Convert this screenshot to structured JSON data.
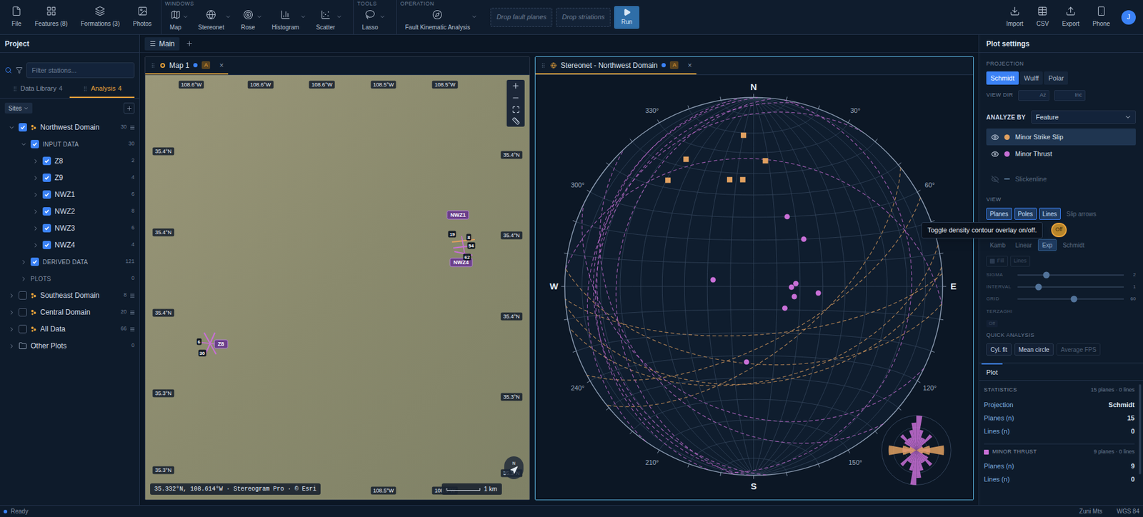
{
  "toolbar": {
    "file_items": [
      {
        "label": "File"
      },
      {
        "label": "Features (8)"
      },
      {
        "label": "Formations (3)"
      },
      {
        "label": "Photos"
      }
    ],
    "groups": [
      {
        "title": "WINDOWS",
        "items": [
          {
            "label": "Map",
            "menu": true
          },
          {
            "label": "Stereonet",
            "menu": true
          },
          {
            "label": "Rose",
            "menu": true
          },
          {
            "label": "Histogram",
            "menu": true
          },
          {
            "label": "Scatter",
            "menu": true
          }
        ]
      },
      {
        "title": "TOOLS",
        "items": [
          {
            "label": "Lasso",
            "menu": true
          }
        ]
      },
      {
        "title": "OPERATION",
        "items": [
          {
            "label": "Fault Kinematic Analysis",
            "menu": true
          }
        ]
      }
    ],
    "drop_zones": [
      "Drop fault planes",
      "Drop striations"
    ],
    "run": {
      "label": "Run",
      "disabled": false
    },
    "right_items": [
      {
        "label": "Import"
      },
      {
        "label": "CSV"
      },
      {
        "label": "Export"
      },
      {
        "label": "Phone"
      }
    ],
    "avatar": "J"
  },
  "sidebar": {
    "title": "Project",
    "filter_placeholder": "Filter stations...",
    "tabs": [
      {
        "label": "Data Library",
        "count": "4",
        "selected": false
      },
      {
        "label": "Analysis",
        "count": "4",
        "selected": true
      }
    ],
    "sites_button": "Sites",
    "tree": [
      {
        "label": "Northwest Domain",
        "count": "30",
        "depth": 0,
        "kind": "domain",
        "checked": true,
        "expanded": true
      },
      {
        "label": "INPUT DATA",
        "count": "30",
        "depth": 1,
        "kind": "section",
        "checked": true,
        "expanded": true
      },
      {
        "label": "Z8",
        "count": "2",
        "depth": 2,
        "kind": "station",
        "checked": true,
        "expanded": false
      },
      {
        "label": "Z9",
        "count": "4",
        "depth": 2,
        "kind": "station",
        "checked": true,
        "expanded": false
      },
      {
        "label": "NWZ1",
        "count": "6",
        "depth": 2,
        "kind": "station",
        "checked": true,
        "expanded": false
      },
      {
        "label": "NWZ2",
        "count": "8",
        "depth": 2,
        "kind": "station",
        "checked": true,
        "expanded": false
      },
      {
        "label": "NWZ3",
        "count": "6",
        "depth": 2,
        "kind": "station",
        "checked": true,
        "expanded": false
      },
      {
        "label": "NWZ4",
        "count": "4",
        "depth": 2,
        "kind": "station",
        "checked": true,
        "expanded": false
      },
      {
        "label": "DERIVED DATA",
        "count": "121",
        "depth": 1,
        "kind": "section",
        "checked": true,
        "expanded": false
      },
      {
        "label": "PLOTS",
        "count": "0",
        "depth": 1,
        "kind": "plots",
        "checked": false,
        "expanded": false
      },
      {
        "label": "Southeast Domain",
        "count": "8",
        "depth": 0,
        "kind": "domain",
        "checked": false,
        "expanded": false
      },
      {
        "label": "Central Domain",
        "count": "20",
        "depth": 0,
        "kind": "domain",
        "checked": false,
        "expanded": false
      },
      {
        "label": "All Data",
        "count": "66",
        "depth": 0,
        "kind": "domain",
        "checked": false,
        "expanded": false
      },
      {
        "label": "Other Plots",
        "count": "0",
        "depth": 0,
        "kind": "folder",
        "checked": false,
        "expanded": false
      }
    ]
  },
  "main_tabs": [
    {
      "label": "Main",
      "selected": true
    }
  ],
  "map": {
    "title": "Map 1",
    "badge": "A",
    "close": "×",
    "selected": false,
    "ticks_top": [
      "108.6°W",
      "108.6°W",
      "108.6°W",
      "108.5°W",
      "108.5°W"
    ],
    "ticks_bottom": [
      "108.5°W",
      "108.5°W"
    ],
    "ticks_left": [
      "35.4°N",
      "35.4°N",
      "35.4°N",
      "35.3°N",
      "35.3°N"
    ],
    "ticks_right": [
      "35.4°N",
      "35.4°N",
      "35.4°N",
      "35.3°N",
      "35.3°N"
    ],
    "stations": [
      {
        "label": "NWZ1"
      },
      {
        "label": "NWZ4"
      },
      {
        "label": "Z8"
      }
    ],
    "dips": [
      {
        "label": "19"
      },
      {
        "label": "8"
      },
      {
        "label": "54"
      },
      {
        "label": "62"
      },
      {
        "label": "6"
      },
      {
        "label": "30"
      }
    ],
    "readout": "35.332°N, 108.614°W · Stereogram Pro · © Esri",
    "scale": "1 km",
    "north": "N"
  },
  "stereonet": {
    "title": "Stereonet - Northwest Domain",
    "badge": "A",
    "close": "×",
    "selected": true,
    "labels": [
      {
        "label": "N",
        "value": 0
      },
      {
        "label": "30°",
        "value": 30
      },
      {
        "label": "60°",
        "value": 60
      },
      {
        "label": "E",
        "value": 90
      },
      {
        "label": "120°",
        "value": 120
      },
      {
        "label": "150°",
        "value": 150
      },
      {
        "label": "S",
        "value": 180
      },
      {
        "label": "210°",
        "value": 210
      },
      {
        "label": "240°",
        "value": 240
      },
      {
        "label": "W",
        "value": 270
      },
      {
        "label": "300°",
        "value": 300
      },
      {
        "label": "330°",
        "value": 330
      }
    ],
    "series": [
      {
        "name": "Minor Strike Slip",
        "color": "#e0a060",
        "marker": "square",
        "poles": [
          [
            -0.054,
            0.8
          ],
          [
            -0.358,
            0.673
          ],
          [
            0.062,
            0.665
          ],
          [
            -0.454,
            0.562
          ],
          [
            -0.127,
            0.565
          ],
          [
            -0.058,
            0.565
          ]
        ],
        "rose": [
          0,
          0,
          0,
          0,
          0,
          0,
          1,
          2,
          4,
          4,
          2,
          1,
          0,
          0,
          0,
          0,
          0,
          0
        ]
      },
      {
        "name": "Minor Thrust",
        "color": "#c86fd6",
        "marker": "circle",
        "poles": [
          [
            0.177,
            0.369
          ],
          [
            0.265,
            0.25
          ],
          [
            -0.215,
            0.035
          ],
          [
            0.223,
            0.015
          ],
          [
            0.2,
            -0.004
          ],
          [
            0.215,
            -0.054
          ],
          [
            0.342,
            -0.035
          ],
          [
            0.165,
            -0.115
          ],
          [
            -0.038,
            -0.4
          ]
        ],
        "rose": [
          5,
          3,
          2,
          2,
          3,
          1,
          1,
          1,
          2,
          2,
          1,
          1,
          2,
          3,
          2,
          2,
          3,
          4
        ]
      }
    ]
  },
  "settings": {
    "title": "Plot settings",
    "projection": {
      "label": "PROJECTION",
      "options": [
        {
          "label": "Schmidt",
          "selected": true
        },
        {
          "label": "Wulff",
          "selected": false
        },
        {
          "label": "Polar",
          "selected": false
        }
      ]
    },
    "view_dir": {
      "label": "VIEW DIR",
      "fields": [
        {
          "placeholder": "Az"
        },
        {
          "placeholder": "Inc"
        }
      ]
    },
    "analyze_by": {
      "label": "ANALYZE BY",
      "value": "Feature"
    },
    "features": [
      {
        "name": "Minor Strike Slip",
        "color": "#e0a060",
        "visible": true,
        "selected": true,
        "kind": "plane"
      },
      {
        "name": "Minor Thrust",
        "color": "#c86fd6",
        "visible": true,
        "selected": false,
        "kind": "plane"
      },
      {
        "name": "Slickenline",
        "color": "#5b7a99",
        "visible": false,
        "selected": false,
        "kind": "line"
      }
    ],
    "view": {
      "label": "VIEW",
      "options": [
        {
          "label": "Planes",
          "on": true
        },
        {
          "label": "Poles",
          "on": true
        },
        {
          "label": "Lines",
          "on": true
        },
        {
          "label": "Slip arrows",
          "on": false
        }
      ]
    },
    "density": {
      "toggle": "Off",
      "on": false,
      "tooltip": "Toggle density contour overlay on/off.",
      "disabled": true,
      "methods": [
        {
          "label": "Kamb",
          "selected": false
        },
        {
          "label": "Linear",
          "selected": false
        },
        {
          "label": "Exp",
          "selected": true
        },
        {
          "label": "Schmidt",
          "selected": false
        }
      ],
      "render": [
        {
          "label": "Fill",
          "on": false
        },
        {
          "label": "Lines",
          "on": false
        }
      ],
      "sliders": [
        {
          "label": "SIGMA",
          "level": 0.27,
          "value": "2"
        },
        {
          "label": "INTERVAL",
          "level": 0.2,
          "value": "1"
        },
        {
          "label": "GRID",
          "level": 0.53,
          "value": "60"
        }
      ]
    },
    "terzaghi": {
      "label": "TERZAGHI",
      "value": "Off",
      "disabled": true
    },
    "quick": {
      "label": "QUICK ANALYSIS",
      "buttons": [
        {
          "label": "Cyl. fit",
          "disabled": false
        },
        {
          "label": "Mean circle",
          "disabled": false
        },
        {
          "label": "Average FPS",
          "disabled": true
        }
      ]
    }
  },
  "plot_tab": {
    "label": "Plot"
  },
  "statistics": {
    "label": "STATISTICS",
    "summary": "15 planes · 0 lines",
    "rows": [
      {
        "label": "Projection",
        "value": "Schmidt"
      },
      {
        "label": "Planes (n)",
        "value": "15"
      },
      {
        "label": "Lines (n)",
        "value": "0"
      }
    ],
    "groups": [
      {
        "name": "MINOR THRUST",
        "color": "#c86fd6",
        "summary": "9 planes · 0 lines",
        "rows": [
          {
            "label": "Planes (n)",
            "value": "9"
          },
          {
            "label": "Lines (n)",
            "value": "0"
          }
        ]
      }
    ]
  },
  "status": {
    "text": "Ready",
    "right": [
      "Zuni Mts",
      "WGS 84"
    ]
  }
}
